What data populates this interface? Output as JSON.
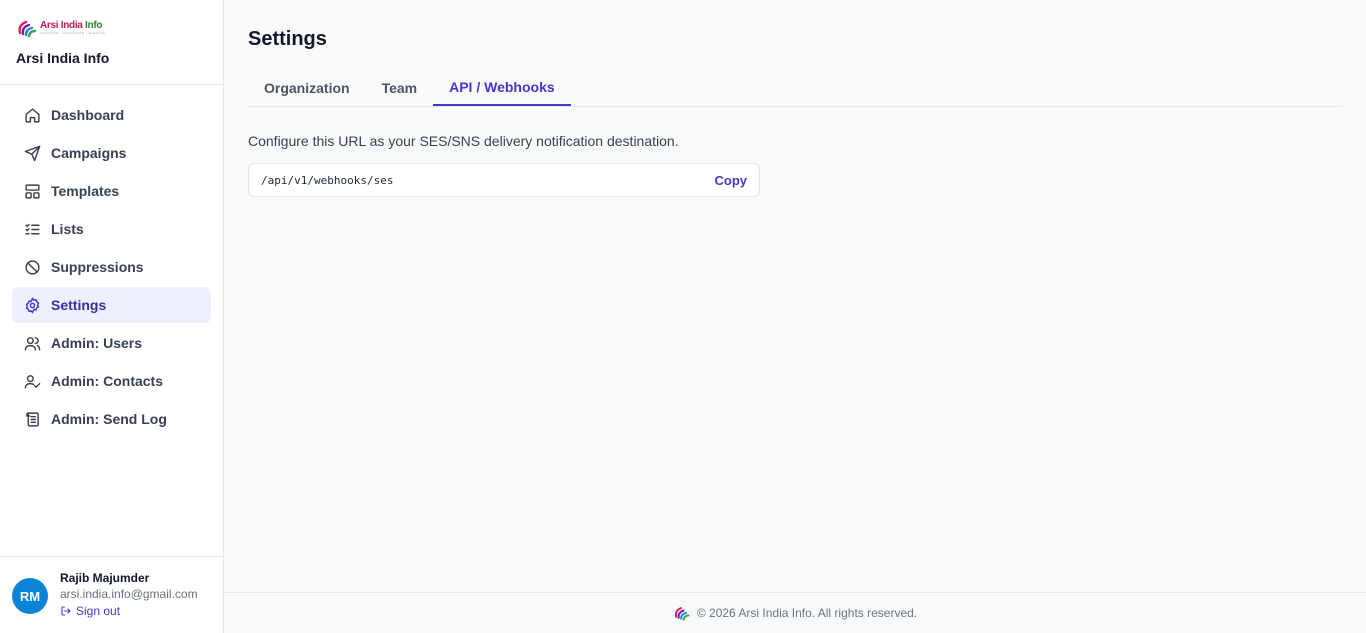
{
  "brand": {
    "logo_word_1": "Arsi India",
    "logo_word_2": " Info",
    "logo_tagline": "INNOVATE • INTEGRATE • ELEVATE",
    "name": "Arsi India Info"
  },
  "nav": [
    {
      "label": "Dashboard",
      "icon": "home-icon",
      "active": false
    },
    {
      "label": "Campaigns",
      "icon": "send-icon",
      "active": false
    },
    {
      "label": "Templates",
      "icon": "layout-icon",
      "active": false
    },
    {
      "label": "Lists",
      "icon": "list-check-icon",
      "active": false
    },
    {
      "label": "Suppressions",
      "icon": "ban-icon",
      "active": false
    },
    {
      "label": "Settings",
      "icon": "gear-icon",
      "active": true
    },
    {
      "label": "Admin: Users",
      "icon": "users-icon",
      "active": false
    },
    {
      "label": "Admin: Contacts",
      "icon": "user-check-icon",
      "active": false
    },
    {
      "label": "Admin: Send Log",
      "icon": "scroll-icon",
      "active": false
    }
  ],
  "user": {
    "initials": "RM",
    "name": "Rajib Majumder",
    "email": "arsi.india.info@gmail.com",
    "signout_label": "Sign out"
  },
  "page": {
    "title": "Settings",
    "tabs": [
      {
        "label": "Organization",
        "active": false
      },
      {
        "label": "Team",
        "active": false
      },
      {
        "label": "API / Webhooks",
        "active": true
      }
    ],
    "description": "Configure this URL as your SES/SNS delivery notification destination.",
    "webhook_url": "/api/v1/webhooks/ses",
    "copy_label": "Copy"
  },
  "footer": {
    "text": "© 2026 Arsi India Info. All rights reserved."
  },
  "colors": {
    "accent": "#4338ca",
    "active_bg": "#eef0ff",
    "avatar": "#0b84d8"
  }
}
